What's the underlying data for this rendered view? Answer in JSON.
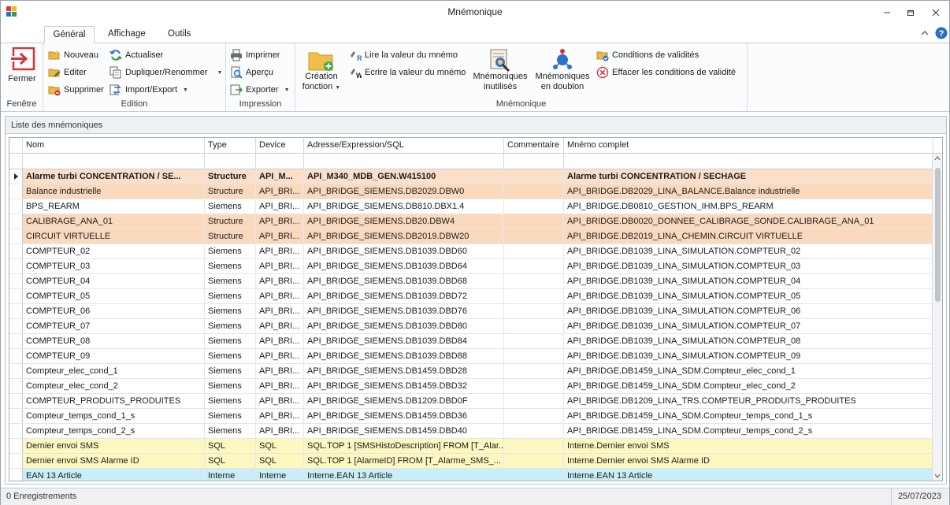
{
  "window": {
    "title": "Mnémonique"
  },
  "tabs": [
    "Général",
    "Affichage",
    "Outils"
  ],
  "ribbon": {
    "fenetre": {
      "label": "Fenêtre",
      "fermer": "Fermer"
    },
    "edition": {
      "label": "Edition",
      "nouveau": "Nouveau",
      "editer": "Editer",
      "supprimer": "Supprimer",
      "actualiser": "Actualiser",
      "dupliquer": "Dupliquer/Renommer",
      "import_export": "Import/Export"
    },
    "impression": {
      "label": "Impression",
      "imprimer": "Imprimer",
      "apercu": "Aperçu",
      "exporter": "Exporter"
    },
    "mnemonique": {
      "label": "Mnémonique",
      "creation_1": "Création",
      "creation_2": "fonction",
      "lire": "Lire la valeur du mnémo",
      "ecrire": "Ecrire la valeur du mnémo",
      "inutilises_1": "Mnémoniques",
      "inutilises_2": "inutilisés",
      "doublon_1": "Mnémoniques",
      "doublon_2": "en doublon",
      "conditions": "Conditions de validités",
      "effacer": "Effacer les conditions de validité"
    }
  },
  "panel": {
    "title": "Liste des mnémoniques"
  },
  "grid": {
    "columns": [
      "Nom",
      "Type",
      "Device",
      "Adresse/Expression/SQL",
      "Commentaire",
      "Mnémo complet"
    ],
    "rows": [
      {
        "nom": "Alarme turbi CONCENTRATION / SE...",
        "type": "Structure",
        "device": "API_M...",
        "adresse": "API_M340_MDB_GEN.W415100",
        "commentaire": "",
        "complet": "Alarme turbi CONCENTRATION / SECHAGE"
      },
      {
        "nom": "Balance industrielle",
        "type": "Structure",
        "device": "API_BRI...",
        "adresse": "API_BRIDGE_SIEMENS.DB2029.DBW0",
        "commentaire": "",
        "complet": "API_BRIDGE.DB2029_LINA_BALANCE.Balance industrielle"
      },
      {
        "nom": "BPS_REARM",
        "type": "Siemens",
        "device": "API_BRI...",
        "adresse": "API_BRIDGE_SIEMENS.DB810.DBX1.4",
        "commentaire": "",
        "complet": "API_BRIDGE.DB0810_GESTION_IHM.BPS_REARM"
      },
      {
        "nom": "CALIBRAGE_ANA_01",
        "type": "Structure",
        "device": "API_BRI...",
        "adresse": "API_BRIDGE_SIEMENS.DB20.DBW4",
        "commentaire": "",
        "complet": "API_BRIDGE.DB0020_DONNEE_CALIBRAGE_SONDE.CALIBRAGE_ANA_01"
      },
      {
        "nom": "CIRCUIT VIRTUELLE",
        "type": "Structure",
        "device": "API_BRI...",
        "adresse": "API_BRIDGE_SIEMENS.DB2019.DBW20",
        "commentaire": "",
        "complet": "API_BRIDGE.DB2019_LINA_CHEMIN.CIRCUIT VIRTUELLE"
      },
      {
        "nom": "COMPTEUR_02",
        "type": "Siemens",
        "device": "API_BRI...",
        "adresse": "API_BRIDGE_SIEMENS.DB1039.DBD60",
        "commentaire": "",
        "complet": "API_BRIDGE.DB1039_LINA_SIMULATION.COMPTEUR_02"
      },
      {
        "nom": "COMPTEUR_03",
        "type": "Siemens",
        "device": "API_BRI...",
        "adresse": "API_BRIDGE_SIEMENS.DB1039.DBD64",
        "commentaire": "",
        "complet": "API_BRIDGE.DB1039_LINA_SIMULATION.COMPTEUR_03"
      },
      {
        "nom": "COMPTEUR_04",
        "type": "Siemens",
        "device": "API_BRI...",
        "adresse": "API_BRIDGE_SIEMENS.DB1039.DBD68",
        "commentaire": "",
        "complet": "API_BRIDGE.DB1039_LINA_SIMULATION.COMPTEUR_04"
      },
      {
        "nom": "COMPTEUR_05",
        "type": "Siemens",
        "device": "API_BRI...",
        "adresse": "API_BRIDGE_SIEMENS.DB1039.DBD72",
        "commentaire": "",
        "complet": "API_BRIDGE.DB1039_LINA_SIMULATION.COMPTEUR_05"
      },
      {
        "nom": "COMPTEUR_06",
        "type": "Siemens",
        "device": "API_BRI...",
        "adresse": "API_BRIDGE_SIEMENS.DB1039.DBD76",
        "commentaire": "",
        "complet": "API_BRIDGE.DB1039_LINA_SIMULATION.COMPTEUR_06"
      },
      {
        "nom": "COMPTEUR_07",
        "type": "Siemens",
        "device": "API_BRI...",
        "adresse": "API_BRIDGE_SIEMENS.DB1039.DBD80",
        "commentaire": "",
        "complet": "API_BRIDGE.DB1039_LINA_SIMULATION.COMPTEUR_07"
      },
      {
        "nom": "COMPTEUR_08",
        "type": "Siemens",
        "device": "API_BRI...",
        "adresse": "API_BRIDGE_SIEMENS.DB1039.DBD84",
        "commentaire": "",
        "complet": "API_BRIDGE.DB1039_LINA_SIMULATION.COMPTEUR_08"
      },
      {
        "nom": "COMPTEUR_09",
        "type": "Siemens",
        "device": "API_BRI...",
        "adresse": "API_BRIDGE_SIEMENS.DB1039.DBD88",
        "commentaire": "",
        "complet": "API_BRIDGE.DB1039_LINA_SIMULATION.COMPTEUR_09"
      },
      {
        "nom": "Compteur_elec_cond_1",
        "type": "Siemens",
        "device": "API_BRI...",
        "adresse": "API_BRIDGE_SIEMENS.DB1459.DBD28",
        "commentaire": "",
        "complet": "API_BRIDGE.DB1459_LINA_SDM.Compteur_elec_cond_1"
      },
      {
        "nom": "Compteur_elec_cond_2",
        "type": "Siemens",
        "device": "API_BRI...",
        "adresse": "API_BRIDGE_SIEMENS.DB1459.DBD32",
        "commentaire": "",
        "complet": "API_BRIDGE.DB1459_LINA_SDM.Compteur_elec_cond_2"
      },
      {
        "nom": "COMPTEUR_PRODUITS_PRODUITES",
        "type": "Siemens",
        "device": "API_BRI...",
        "adresse": "API_BRIDGE_SIEMENS.DB1209.DBD0F",
        "commentaire": "",
        "complet": "API_BRIDGE.DB1209_LINA_TRS.COMPTEUR_PRODUITS_PRODUITES"
      },
      {
        "nom": "Compteur_temps_cond_1_s",
        "type": "Siemens",
        "device": "API_BRI...",
        "adresse": "API_BRIDGE_SIEMENS.DB1459.DBD36",
        "commentaire": "",
        "complet": "API_BRIDGE.DB1459_LINA_SDM.Compteur_temps_cond_1_s"
      },
      {
        "nom": "Compteur_temps_cond_2_s",
        "type": "Siemens",
        "device": "API_BRI...",
        "adresse": "API_BRIDGE_SIEMENS.DB1459.DBD40",
        "commentaire": "",
        "complet": "API_BRIDGE.DB1459_LINA_SDM.Compteur_temps_cond_2_s"
      },
      {
        "nom": "Dernier envoi SMS",
        "type": "SQL",
        "device": "SQL",
        "adresse": "SQL.TOP 1 [SMSHistoDescription]   FROM [T_Alar...",
        "commentaire": "",
        "complet": "Interne.Dernier envoi SMS"
      },
      {
        "nom": "Dernier envoi SMS Alarme ID",
        "type": "SQL",
        "device": "SQL",
        "adresse": "SQL.TOP 1 [AlarmeID]   FROM [T_Alarme_SMS_...",
        "commentaire": "",
        "complet": "Interne.Dernier envoi SMS Alarme ID"
      },
      {
        "nom": "EAN 13 Article",
        "type": "Interne",
        "device": "Interne",
        "adresse": "Interne.EAN 13 Article",
        "commentaire": "",
        "complet": "Interne.EAN 13 Article"
      }
    ]
  },
  "status": {
    "records": "0 Enregistrements",
    "date": "25/07/2023"
  },
  "colors": {
    "structure_row": "#fbd9bd",
    "sql_row": "#fdf7c0",
    "interne_row": "#c9eef7",
    "selected_row": "#fcdfc8"
  }
}
